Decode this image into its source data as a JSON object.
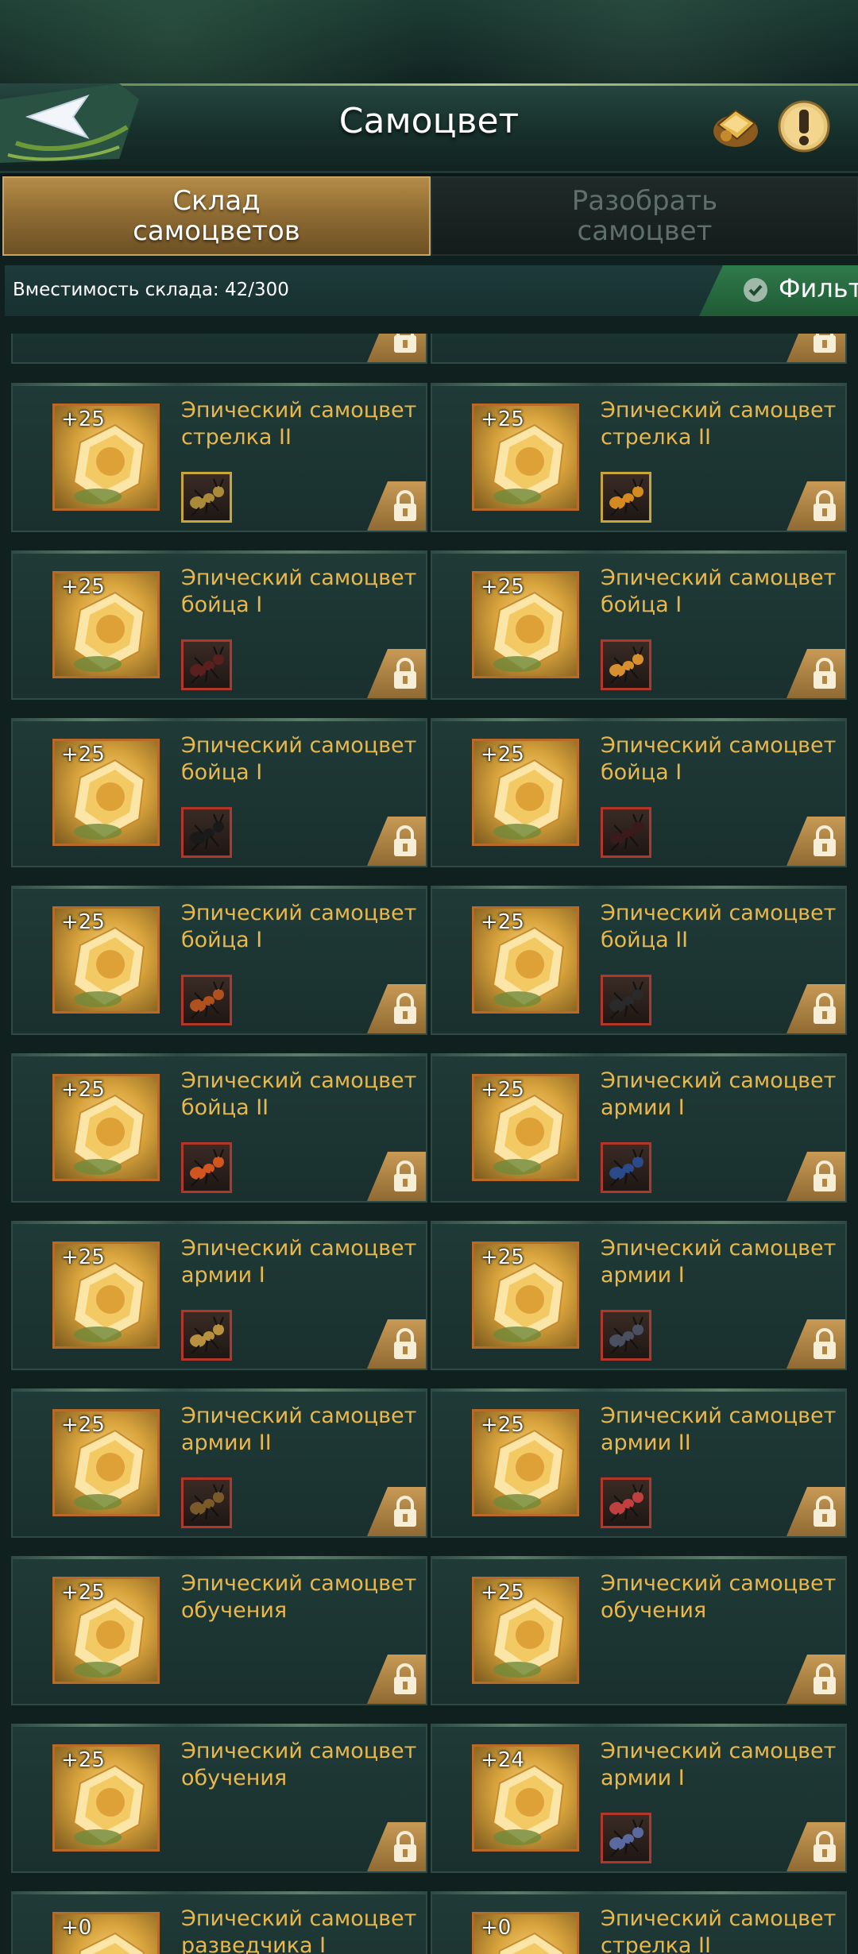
{
  "header": {
    "title": "Самоцвет",
    "back_icon": "back-arrow-icon",
    "book_icon": "gem-book-icon",
    "info_icon": "info-exclamation-icon"
  },
  "tabs": [
    {
      "label": "Склад самоцветов",
      "active": true
    },
    {
      "label": "Разобрать самоцвет",
      "active": false
    }
  ],
  "storage": {
    "capacity_text": "Вместимость склада: 42/300",
    "filter_label": "Фильт"
  },
  "gems": [
    {
      "level": "+25",
      "name": "Эпический самоцвет стрелка II",
      "ant_color": "#a88a3a"
    },
    {
      "level": "+25",
      "name": "Эпический самоцвет стрелка II",
      "ant_color": "#d58a20"
    },
    {
      "level": "+25",
      "name": "Эпический самоцвет бойца I",
      "ant_color": "#5a1f1f"
    },
    {
      "level": "+25",
      "name": "Эпический самоцвет бойца I",
      "ant_color": "#d8902e"
    },
    {
      "level": "+25",
      "name": "Эпический самоцвет бойца I",
      "ant_color": "#1a1a1a"
    },
    {
      "level": "+25",
      "name": "Эпический самоцвет бойца I",
      "ant_color": "#3a1a1a"
    },
    {
      "level": "+25",
      "name": "Эпический самоцвет бойца I",
      "ant_color": "#b0501e"
    },
    {
      "level": "+25",
      "name": "Эпический самоцвет бойца II",
      "ant_color": "#2a2a2a"
    },
    {
      "level": "+25",
      "name": "Эпический самоцвет бойца II",
      "ant_color": "#d0551e"
    },
    {
      "level": "+25",
      "name": "Эпический самоцвет армии I",
      "ant_color": "#2a4a8a"
    },
    {
      "level": "+25",
      "name": "Эпический самоцвет армии I",
      "ant_color": "#b89040"
    },
    {
      "level": "+25",
      "name": "Эпический самоцвет армии I",
      "ant_color": "#4a5060"
    },
    {
      "level": "+25",
      "name": "Эпический самоцвет армии II",
      "ant_color": "#7a5a28"
    },
    {
      "level": "+25",
      "name": "Эпический самоцвет армии II",
      "ant_color": "#c04040"
    },
    {
      "level": "+25",
      "name": "Эпический самоцвет обучения",
      "ant_color": ""
    },
    {
      "level": "+25",
      "name": "Эпический самоцвет обучения",
      "ant_color": ""
    },
    {
      "level": "+25",
      "name": "Эпический самоцвет обучения",
      "ant_color": ""
    },
    {
      "level": "+24",
      "name": "Эпический самоцвет армии I",
      "ant_color": "#5a6aa0"
    },
    {
      "level": "+0",
      "name": "Эпический самоцвет разведчика I",
      "ant_color": ""
    },
    {
      "level": "+0",
      "name": "Эпический самоцвет стрелка II",
      "ant_color": ""
    }
  ],
  "lock_icon": "lock-icon"
}
